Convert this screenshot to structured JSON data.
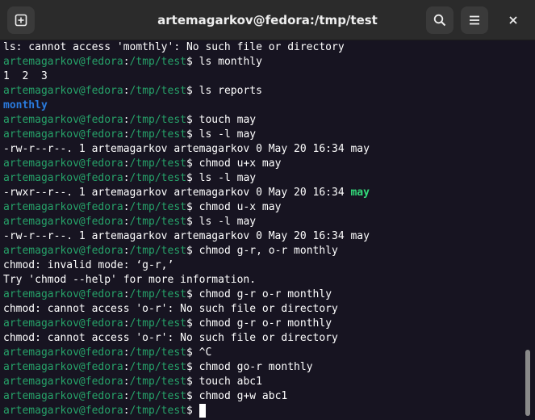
{
  "window": {
    "title": "artemagarkov@fedora:/tmp/test",
    "buttons": {
      "new_tab": "new-tab-icon",
      "search": "search-icon",
      "menu": "hamburger-menu-icon",
      "close": "close-icon"
    }
  },
  "colors": {
    "prompt": "#26a269",
    "directory": "#2a7bde",
    "executable": "#33da7a",
    "background": "#171421",
    "titlebar": "#2b2b2b"
  },
  "prompt": {
    "user_host": "artemagarkov@fedora",
    "colon": ":",
    "path": "/tmp/test",
    "symbol": "$ "
  },
  "terminal": {
    "lines": [
      {
        "type": "out",
        "text": "ls: cannot access 'momthly': No such file or directory"
      },
      {
        "type": "cmd",
        "text": "ls monthly"
      },
      {
        "type": "out",
        "text": "1  2  3"
      },
      {
        "type": "cmd",
        "text": "ls reports"
      },
      {
        "type": "dir",
        "text": "monthly"
      },
      {
        "type": "cmd",
        "text": "touch may"
      },
      {
        "type": "cmd",
        "text": "ls -l may"
      },
      {
        "type": "out",
        "text": "-rw-r--r--. 1 artemagarkov artemagarkov 0 May 20 16:34 may"
      },
      {
        "type": "cmd",
        "text": "chmod u+x may"
      },
      {
        "type": "cmd",
        "text": "ls -l may"
      },
      {
        "type": "exec",
        "text": "-rwxr--r--. 1 artemagarkov artemagarkov 0 May 20 16:34 ",
        "name": "may"
      },
      {
        "type": "cmd",
        "text": "chmod u-x may"
      },
      {
        "type": "cmd",
        "text": "ls -l may"
      },
      {
        "type": "out",
        "text": "-rw-r--r--. 1 artemagarkov artemagarkov 0 May 20 16:34 may"
      },
      {
        "type": "cmd",
        "text": "chmod g-r, o-r monthly"
      },
      {
        "type": "out",
        "text": "chmod: invalid mode: ‘g-r,’"
      },
      {
        "type": "out",
        "text": "Try 'chmod --help' for more information."
      },
      {
        "type": "cmd",
        "text": "chmod g-r o-r monthly"
      },
      {
        "type": "out",
        "text": "chmod: cannot access 'o-r': No such file or directory"
      },
      {
        "type": "cmd",
        "text": "chmod g-r o-r monthly"
      },
      {
        "type": "out",
        "text": "chmod: cannot access 'o-r': No such file or directory"
      },
      {
        "type": "cmd",
        "text": "^C"
      },
      {
        "type": "cmd",
        "text": "chmod go-r monthly"
      },
      {
        "type": "cmd",
        "text": "touch abc1"
      },
      {
        "type": "cmd",
        "text": "chmod g+w abc1"
      },
      {
        "type": "cmd",
        "text": "",
        "cursor": true
      }
    ]
  }
}
